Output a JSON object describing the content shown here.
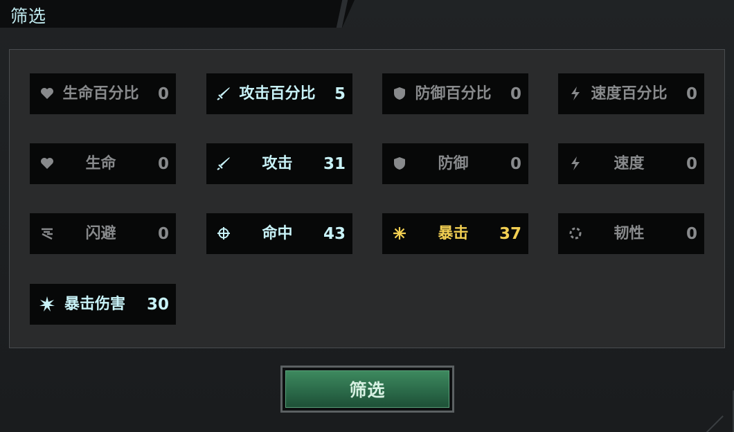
{
  "window": {
    "title": "筛选"
  },
  "stats": {
    "hp_pct": {
      "label": "生命百分比",
      "value": "0",
      "icon": "heart-icon",
      "state": "dim"
    },
    "atk_pct": {
      "label": "攻击百分比",
      "value": "5",
      "icon": "sword-icon",
      "state": "active"
    },
    "def_pct": {
      "label": "防御百分比",
      "value": "0",
      "icon": "shield-icon",
      "state": "dim"
    },
    "spd_pct": {
      "label": "速度百分比",
      "value": "0",
      "icon": "lightning-icon",
      "state": "dim"
    },
    "hp": {
      "label": "生命",
      "value": "0",
      "icon": "heart-icon",
      "state": "dim"
    },
    "atk": {
      "label": "攻击",
      "value": "31",
      "icon": "sword-icon",
      "state": "active"
    },
    "def": {
      "label": "防御",
      "value": "0",
      "icon": "shield-icon",
      "state": "dim"
    },
    "spd": {
      "label": "速度",
      "value": "0",
      "icon": "lightning-icon",
      "state": "dim"
    },
    "dodge": {
      "label": "闪避",
      "value": "0",
      "icon": "dodge-icon",
      "state": "dim"
    },
    "accuracy": {
      "label": "命中",
      "value": "43",
      "icon": "crosshair-icon",
      "state": "active"
    },
    "crit": {
      "label": "暴击",
      "value": "37",
      "icon": "burst-icon",
      "state": "gold"
    },
    "tenacity": {
      "label": "韧性",
      "value": "0",
      "icon": "tenacity-icon",
      "state": "dim"
    },
    "crit_dmg": {
      "label": "暴击伤害",
      "value": "30",
      "icon": "crit-damage-icon",
      "state": "active"
    }
  },
  "footer": {
    "filter_button": "筛选"
  },
  "colors": {
    "active": "#c8f2f7",
    "dim": "#888a8c",
    "gold": "#f2cf52",
    "button": "#2f7350"
  }
}
